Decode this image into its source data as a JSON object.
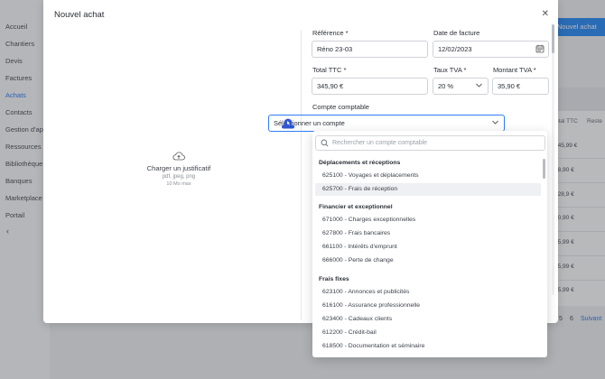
{
  "sidebar": {
    "items": [
      {
        "label": "Accueil",
        "active": false
      },
      {
        "label": "Chantiers",
        "active": false
      },
      {
        "label": "Devis",
        "active": false
      },
      {
        "label": "Factures",
        "active": false
      },
      {
        "label": "Achats",
        "active": true
      },
      {
        "label": "Contacts",
        "active": false
      },
      {
        "label": "Gestion d'app",
        "active": false
      },
      {
        "label": "Ressources",
        "active": false
      },
      {
        "label": "Bibliothèque",
        "active": false
      },
      {
        "label": "Banques",
        "active": false
      },
      {
        "label": "Marketplace",
        "active": false
      },
      {
        "label": "Portail",
        "active": false
      }
    ],
    "collapse_icon": "chevron-left-icon"
  },
  "background": {
    "new_button_label": "Nouvel achat",
    "columns": [
      "otal TTC",
      "Reste"
    ],
    "rows": [
      "345,99 €",
      "28,90 €",
      "128,9 €",
      "40,90 €",
      "65,99 €",
      "45,99 €",
      "45,99 €"
    ],
    "pagination": [
      "5",
      "6",
      "Suivant"
    ]
  },
  "modal": {
    "title": "Nouvel achat",
    "close_icon": "close-icon",
    "upload": {
      "icon": "cloud-upload-icon",
      "label": "Charger un justificatif",
      "formats": "pdf, jpeg, png",
      "max_size": "10 Mo max"
    },
    "form": {
      "reference": {
        "label": "Référence *",
        "value": "Réno 23-03"
      },
      "invoice_date": {
        "label": "Date de facture",
        "value": "12/02/2023",
        "icon": "calendar-icon"
      },
      "total_ttc": {
        "label": "Total TTC *",
        "value": "345,90 €"
      },
      "vat_rate": {
        "label": "Taux TVA *",
        "value": "20 %",
        "icon": "chevron-down-icon"
      },
      "vat_amount": {
        "label": "Montant TVA *",
        "value": "35,90 €"
      },
      "account": {
        "label": "Compte comptable",
        "placeholder": "Sélectionner un compte",
        "icon": "chevron-up-icon"
      }
    },
    "dropdown": {
      "search_placeholder": "Rechercher un compte comptable",
      "search_icon": "search-icon",
      "groups": [
        {
          "label": "Déplacements et réceptions",
          "options": [
            {
              "code": "625100",
              "name": "Voyages et déplacements",
              "highlighted": false
            },
            {
              "code": "625700",
              "name": "Frais de réception",
              "highlighted": true
            }
          ]
        },
        {
          "label": "Financier et exceptionnel",
          "options": [
            {
              "code": "671000",
              "name": "Charges exceptionnelles",
              "highlighted": false
            },
            {
              "code": "627800",
              "name": "Frais bancaires",
              "highlighted": false
            },
            {
              "code": "661100",
              "name": "Intérêts d'emprunt",
              "highlighted": false
            },
            {
              "code": "666000",
              "name": "Perte de change",
              "highlighted": false
            }
          ]
        },
        {
          "label": "Frais fixes",
          "options": [
            {
              "code": "623100",
              "name": "Annonces et publicités",
              "highlighted": false
            },
            {
              "code": "616100",
              "name": "Assurance professionnelle",
              "highlighted": false
            },
            {
              "code": "623400",
              "name": "Cadeaux clients",
              "highlighted": false
            },
            {
              "code": "612200",
              "name": "Crédit-bail",
              "highlighted": false
            },
            {
              "code": "618500",
              "name": "Documentation et séminaire",
              "highlighted": false
            }
          ]
        }
      ]
    }
  },
  "colors": {
    "accent": "#2f7cf6",
    "highlight": "#eef0f3"
  }
}
